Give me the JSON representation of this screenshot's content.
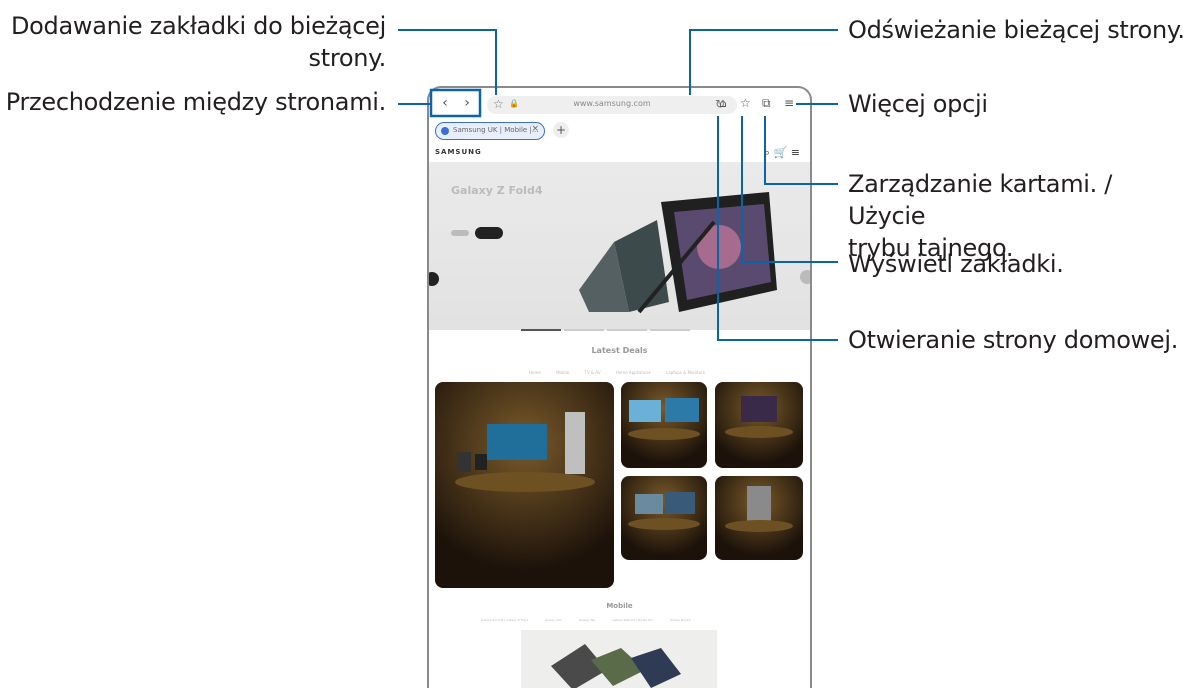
{
  "callouts": {
    "bookmark_add": "Dodawanie zakładki do bieżącej\nstrony.",
    "navigate": "Przechodzenie między stronami.",
    "refresh": "Odświeżanie bieżącej strony.",
    "more_options": "Więcej opcji",
    "tabs_manage": "Zarządzanie kartami. / Użycie\ntrybu tajnego.",
    "bookmarks_view": "Wyświetl zakładki.",
    "homepage": "Otwieranie strony domowej."
  },
  "browser": {
    "url": "www.samsung.com",
    "tab_title": "Samsung UK | Mobile |...",
    "logo": "SAMSUNG",
    "hero_title": "Galaxy Z Fold4",
    "deals_title": "Latest Deals",
    "deals_tabs": [
      "Home",
      "Mobile",
      "TV & AV",
      "Home Appliances",
      "Laptops & Monitors"
    ],
    "mobile_title": "Mobile",
    "mobile_tabs": [
      "Galaxy Z Fold4 | Galaxy Z Flip4",
      "Galaxy S22",
      "Galaxy Tab",
      "Galaxy Watch5 | Buds2 Pro",
      "Galaxy Book2"
    ]
  }
}
